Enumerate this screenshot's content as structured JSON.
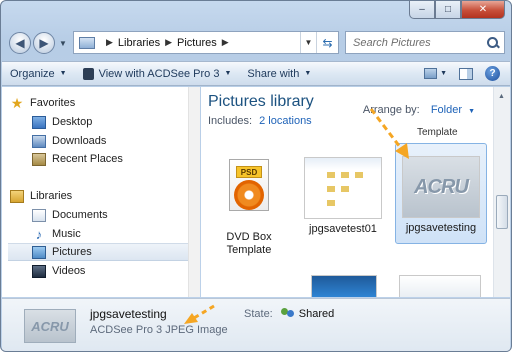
{
  "window": {
    "caption_buttons": {
      "minimize": "–",
      "maximize": "□",
      "close": "✕"
    }
  },
  "address": {
    "crumbs": [
      "Libraries",
      "Pictures"
    ],
    "search_placeholder": "Search Pictures"
  },
  "toolbar": {
    "organize": "Organize",
    "view_with": "View with ACDSee Pro 3",
    "share_with": "Share with"
  },
  "sidebar": {
    "favorites_label": "Favorites",
    "favorites": [
      "Desktop",
      "Downloads",
      "Recent Places"
    ],
    "libraries_label": "Libraries",
    "libraries": [
      "Documents",
      "Music",
      "Pictures",
      "Videos"
    ],
    "selected": "Pictures"
  },
  "main": {
    "title": "Pictures library",
    "includes_label": "Includes:",
    "includes_link": "2 locations",
    "arrange_label": "Arrange by:",
    "arrange_value": "Folder",
    "cut_label": "Template",
    "tiles": [
      {
        "label": "DVD Box Template",
        "psd_tag": "PSD"
      },
      {
        "label": "jpgsavetest01"
      },
      {
        "label": "jpgsavetesting",
        "selected": true,
        "logo_text": "ACRU"
      }
    ]
  },
  "details": {
    "name": "jpgsavetesting",
    "type": "ACDSee Pro 3 JPEG Image",
    "state_label": "State:",
    "state_value": "Shared",
    "logo_text": "ACRU"
  },
  "colors": {
    "accent": "#1f63b8",
    "arrow": "#f5a623",
    "title": "#1c5280"
  }
}
